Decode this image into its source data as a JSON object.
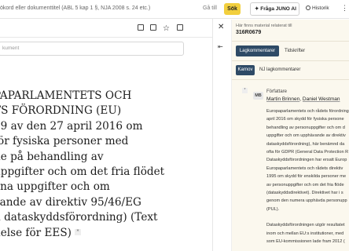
{
  "topbar": {
    "search_text": "ökord eller dokumenttitel (ABL 5 kap 1 §, NJA 2008 s. 24 etc.)",
    "goto_label": "Gå till",
    "search_button": "Sök",
    "ask_juno_button": "Fråga JUNO AI",
    "history_label": "Historik",
    "more_icon": "more-dots-icon"
  },
  "doc": {
    "search_placeholder": "kument",
    "title_lines": [
      "PAPARLAMENTETS OCH",
      "TS FÖRORDNING (EU)",
      "79 av den 27 april 2016 om",
      "för fysiska personer med",
      "de på behandling av",
      "uppgifter och om det fria flödet",
      "ana uppgifter och om",
      "vande av direktiv 95/46/EG",
      "n dataskyddsförordning) (Text",
      "delse för EES)"
    ],
    "footnote_marker": "*"
  },
  "panel": {
    "header": "Här finns material relaterat till",
    "doc_id": "316R0679",
    "tabs": [
      "Lagkommentarer",
      "Tidskrifter"
    ],
    "subtabs": [
      "Karnov",
      "NJ lagkommentarer"
    ],
    "footnote_marker": "*",
    "author_badge": "MB",
    "author_label": "Författare",
    "authors": [
      "Martin Brinnen",
      "Daniel Westman"
    ],
    "author_separator": ", ",
    "comment_lines": [
      "Europaparlamentets och rådets förordning",
      "april 2016 om skydd för fysiska persone",
      "behandling av personuppgifter och om d",
      "uppgifter och om upphävande av direktiv",
      "dataskyddsförordning), här benämnd da",
      "ofta för GDPR (General Data Protection R",
      "Dataskyddsförordningen har ersatt Europ",
      "Europaparlamentets och rådets direktiv",
      "1995 om skydd för enskilda personer me",
      "av personuppgifter och om det fria flöde",
      "(dataskyddsdirektivet). Direktivet har i s",
      "genom den numera upphävda personupp",
      "(PUL).",
      "",
      "Dataskyddsförordningen utgör resultatet",
      "inom och mellan EU:s institutioner, med",
      "som EU-kommissionen lade fram 2012 ("
    ]
  },
  "colors": {
    "accent_yellow": "#f2cf3e",
    "tab_active": "#2e4a66",
    "panel_bg": "#fbf8ee"
  }
}
